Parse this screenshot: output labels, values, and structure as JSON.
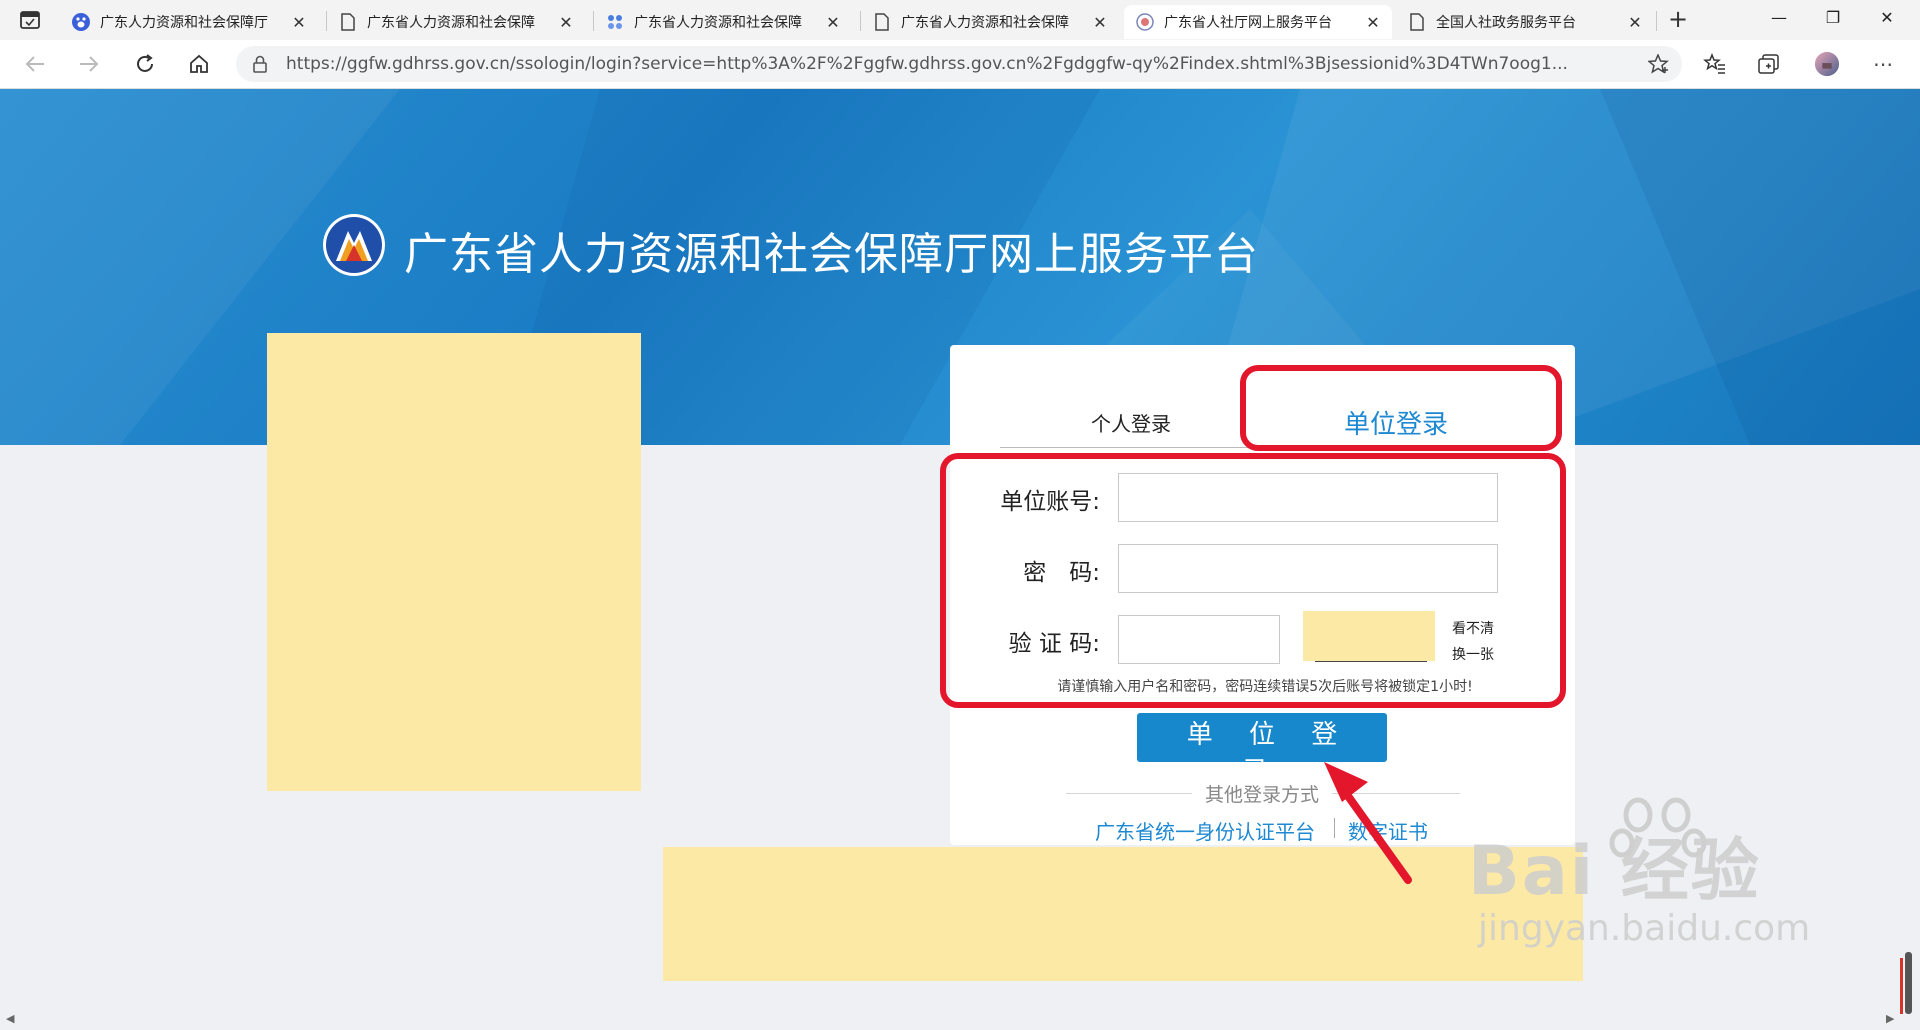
{
  "browser": {
    "tabs": [
      {
        "title": "广东人力资源和社会保障厅",
        "favicon": "baidu-paw-icon",
        "active": false
      },
      {
        "title": "广东省人力资源和社会保障",
        "favicon": "page-icon",
        "active": false
      },
      {
        "title": "广东省人力资源和社会保障",
        "favicon": "baidu-paw-icon",
        "active": false
      },
      {
        "title": "广东省人力资源和社会保障",
        "favicon": "page-icon",
        "active": false
      },
      {
        "title": "广东省人社厅网上服务平台",
        "favicon": "site-logo-icon",
        "active": true
      },
      {
        "title": "全国人社政务服务平台",
        "favicon": "page-icon",
        "active": false
      }
    ],
    "address_bar": {
      "url": "https://ggfw.gdhrss.gov.cn/ssologin/login?service=http%3A%2F%2Fggfw.gdhrss.gov.cn%2Fgdggfw-qy%2Findex.shtml%3Bjsessionid%3D4TWn7oog1..."
    },
    "accent_color": "#1e88d2"
  },
  "page": {
    "site_title": "广东省人力资源和社会保障厅网上服务平台",
    "login_tabs": {
      "personal": "个人登录",
      "unit": "单位登录"
    },
    "form": {
      "account_label": "单位账号:",
      "password_label": "密　码:",
      "captcha_label": "验 证 码:",
      "captcha_unclear": "看不清",
      "captcha_refresh": "换一张",
      "warning": "请谨慎输入用户名和密码，密码连续错误5次后账号将被锁定1小时!"
    },
    "login_button": "单 位 登 录",
    "other_methods": {
      "label": "其他登录方式",
      "unified_auth": "广东省统一身份认证平台",
      "digital_cert": "数字证书"
    },
    "watermark": {
      "main": "Bai 经验",
      "sub": "jingyan.baidu.com"
    }
  }
}
